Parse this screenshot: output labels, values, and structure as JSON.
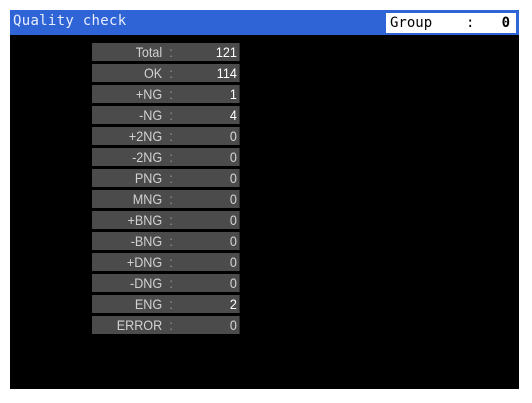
{
  "header": {
    "title": "Quality check",
    "group_label": "Group",
    "group_sep": ":",
    "group_value": "0"
  },
  "rows": [
    {
      "label": "Total",
      "sep": ":",
      "value": "121"
    },
    {
      "label": "OK",
      "sep": ":",
      "value": "114"
    },
    {
      "label": "+NG",
      "sep": ":",
      "value": "1"
    },
    {
      "label": "-NG",
      "sep": ":",
      "value": "4"
    },
    {
      "label": "+2NG",
      "sep": ":",
      "value": "0"
    },
    {
      "label": "-2NG",
      "sep": ":",
      "value": "0"
    },
    {
      "label": "PNG",
      "sep": ":",
      "value": "0"
    },
    {
      "label": "MNG",
      "sep": ":",
      "value": "0"
    },
    {
      "label": "+BNG",
      "sep": ":",
      "value": "0"
    },
    {
      "label": "-BNG",
      "sep": ":",
      "value": "0"
    },
    {
      "label": "+DNG",
      "sep": ":",
      "value": "0"
    },
    {
      "label": "-DNG",
      "sep": ":",
      "value": "0"
    },
    {
      "label": "ENG",
      "sep": ":",
      "value": "2"
    },
    {
      "label": "ERROR",
      "sep": ":",
      "value": "0"
    }
  ],
  "colors": {
    "titlebar": "#2f64d6",
    "background": "#000000",
    "row_bg": "#4b4b4b",
    "text": "#ffffff"
  }
}
